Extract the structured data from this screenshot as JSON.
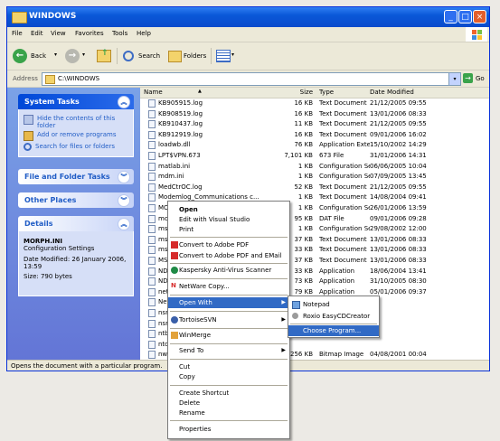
{
  "window": {
    "title": "WINDOWS",
    "min": "_",
    "max": "□",
    "close": "×"
  },
  "menu": [
    "File",
    "Edit",
    "View",
    "Favorites",
    "Tools",
    "Help"
  ],
  "toolbar": {
    "back": "Back",
    "search": "Search",
    "folders": "Folders"
  },
  "address": {
    "label": "Address",
    "path": "C:\\WINDOWS",
    "go": "Go"
  },
  "left": {
    "system_tasks": {
      "title": "System Tasks",
      "items": [
        "Hide the contents of this folder",
        "Add or remove programs",
        "Search for files or folders"
      ]
    },
    "file_folder_tasks": "File and Folder Tasks",
    "other_places": "Other Places",
    "details": {
      "title": "Details",
      "name": "MORPH.INI",
      "type": "Configuration Settings",
      "modified": "Date Modified: 26 January 2006, 13:59",
      "size": "Size: 790 bytes"
    }
  },
  "columns": [
    "Name",
    "Size",
    "Type",
    "Date Modified"
  ],
  "files": [
    {
      "name": "KB905915.log",
      "size": "16 KB",
      "type": "Text Document",
      "date": "21/12/2005 09:55"
    },
    {
      "name": "KB908519.log",
      "size": "16 KB",
      "type": "Text Document",
      "date": "13/01/2006 08:33"
    },
    {
      "name": "KB910437.log",
      "size": "11 KB",
      "type": "Text Document",
      "date": "21/12/2005 09:55"
    },
    {
      "name": "KB912919.log",
      "size": "16 KB",
      "type": "Text Document",
      "date": "09/01/2006 16:02"
    },
    {
      "name": "loadwb.dll",
      "size": "76 KB",
      "type": "Application Extension",
      "date": "15/10/2002 14:29"
    },
    {
      "name": "LPT$VPN.673",
      "size": "7,101 KB",
      "type": "673 File",
      "date": "31/01/2006 14:31"
    },
    {
      "name": "matlab.ini",
      "size": "1 KB",
      "type": "Configuration Settings",
      "date": "06/06/2005 10:04"
    },
    {
      "name": "mdm.ini",
      "size": "1 KB",
      "type": "Configuration Settings",
      "date": "07/09/2005 13:45"
    },
    {
      "name": "MedCtrOC.log",
      "size": "52 KB",
      "type": "Text Document",
      "date": "21/12/2005 09:55"
    },
    {
      "name": "Modemlog_Communications c...",
      "size": "1 KB",
      "type": "Text Document",
      "date": "14/08/2004 09:41"
    },
    {
      "name": "MORPH.INI",
      "size": "1 KB",
      "type": "Configuration Settings",
      "date": "26/01/2006 13:59"
    },
    {
      "name": "moz",
      "size": "95 KB",
      "type": "DAT File",
      "date": "09/01/2006 09:28"
    },
    {
      "name": "msd",
      "size": "1 KB",
      "type": "Configuration Settings",
      "date": "29/08/2002 12:00"
    },
    {
      "name": "msm",
      "size": "37 KB",
      "type": "Text Document",
      "date": "13/01/2006 08:33"
    },
    {
      "name": "msm",
      "size": "33 KB",
      "type": "Text Document",
      "date": "13/01/2006 08:33"
    },
    {
      "name": "MSV",
      "size": "37 KB",
      "type": "Text Document",
      "date": "13/01/2006 08:33"
    },
    {
      "name": "NDN",
      "size": "33 KB",
      "type": "Application",
      "date": "18/06/2004 13:41"
    },
    {
      "name": "NDN",
      "size": "73 KB",
      "type": "Application",
      "date": "31/10/2005 08:30"
    },
    {
      "name": "net",
      "size": "79 KB",
      "type": "Application",
      "date": "05/01/2006 09:37"
    },
    {
      "name": "Netv",
      "size": "",
      "type": "",
      "date": ""
    },
    {
      "name": "nsre",
      "size": "",
      "type": "",
      "date": ""
    },
    {
      "name": "nsre",
      "size": "",
      "type": "",
      "date": ""
    },
    {
      "name": "ntbt",
      "size": "",
      "type": "",
      "date": ""
    },
    {
      "name": "ntdt",
      "size": "",
      "type": "",
      "date": ""
    },
    {
      "name": "nwe",
      "size": "256 KB",
      "type": "Bitmap Image",
      "date": "04/08/2001 00:04"
    }
  ],
  "status": "Opens the document with a particular program.",
  "context_menu": {
    "open": "Open",
    "edit_vs": "Edit with Visual Studio",
    "print": "Print",
    "convert_pdf": "Convert to Adobe PDF",
    "convert_pdf_email": "Convert to Adobe PDF and EMail",
    "kaspersky": "Kaspersky Anti-Virus Scanner",
    "netware": "NetWare Copy...",
    "open_with": "Open With",
    "tortoise": "TortoiseSVN",
    "winmerge": "WinMerge",
    "send_to": "Send To",
    "cut": "Cut",
    "copy": "Copy",
    "create_shortcut": "Create Shortcut",
    "delete": "Delete",
    "rename": "Rename",
    "properties": "Properties"
  },
  "submenu": {
    "notepad": "Notepad",
    "roxio": "Roxio EasyCDCreator",
    "choose": "Choose Program..."
  }
}
